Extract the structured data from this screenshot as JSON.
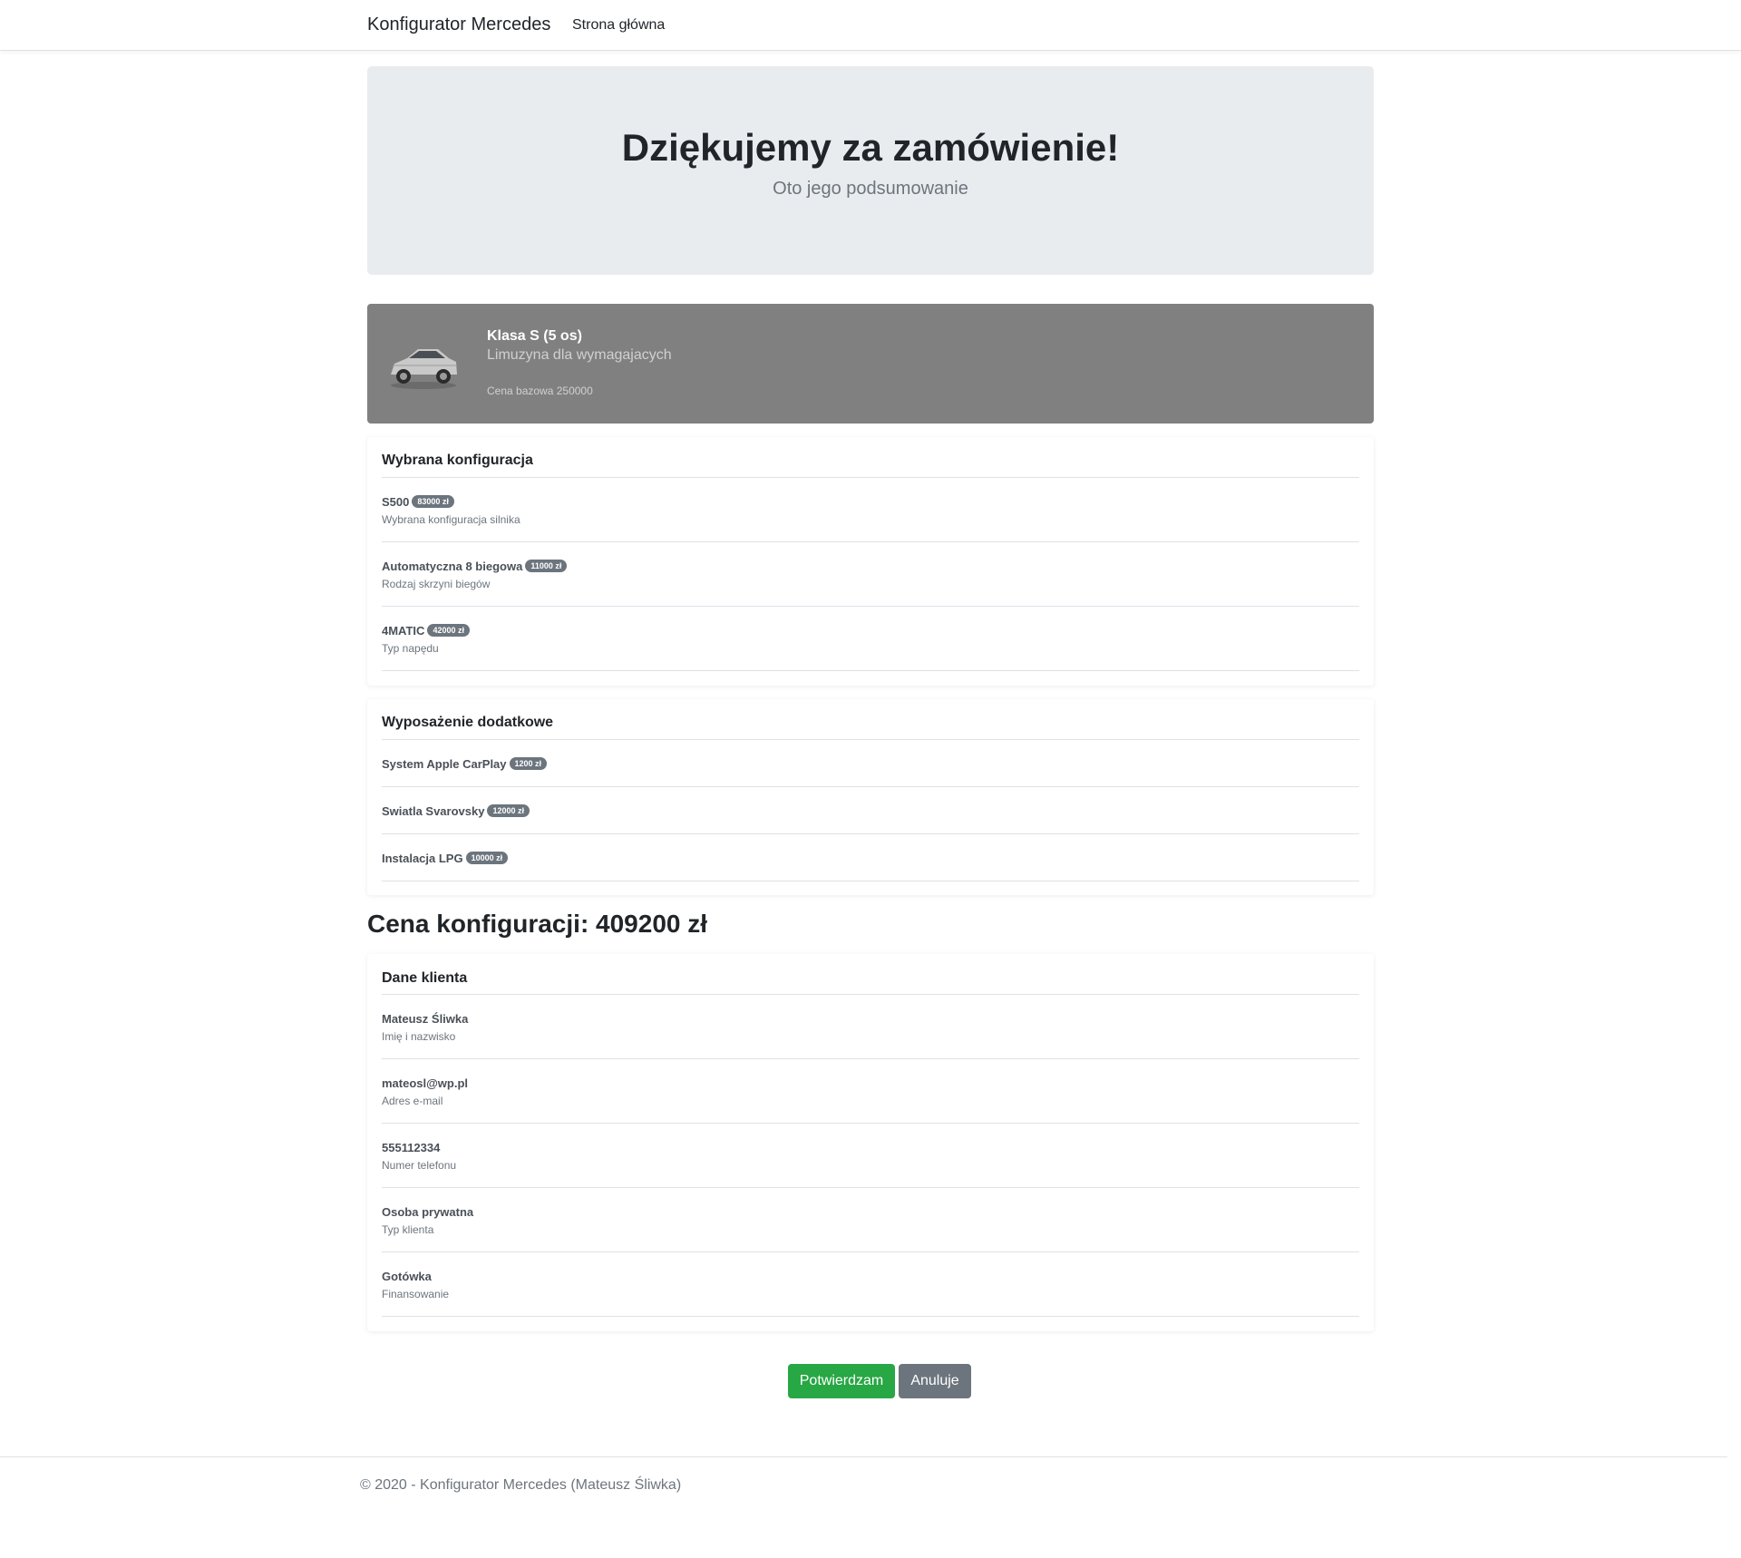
{
  "navbar": {
    "brand": "Konfigurator Mercedes",
    "home_link": "Strona główna"
  },
  "jumbotron": {
    "title": "Dziękujemy za zamówienie!",
    "lead": "Oto jego podsumowanie"
  },
  "model": {
    "title": "Klasa S (5 os)",
    "subtitle": "Limuzyna dla wymagajacych",
    "base_price": "Cena bazowa 250000"
  },
  "config": {
    "title": "Wybrana konfiguracja",
    "items": [
      {
        "name": "S500",
        "price": "83000 zł",
        "desc": "Wybrana konfiguracja silnika"
      },
      {
        "name": "Automatyczna 8 biegowa",
        "price": "11000 zł",
        "desc": "Rodzaj skrzyni biegów"
      },
      {
        "name": "4MATIC",
        "price": "42000 zł",
        "desc": "Typ napędu"
      }
    ]
  },
  "extras": {
    "title": "Wyposażenie dodatkowe",
    "items": [
      {
        "name": "System Apple CarPlay",
        "price": "1200 zł"
      },
      {
        "name": "Swiatla Svarovsky",
        "price": "12000 zł"
      },
      {
        "name": "Instalacja LPG",
        "price": "10000 zł"
      }
    ]
  },
  "total": {
    "label": "Cena konfiguracji: 409200 zł"
  },
  "client": {
    "title": "Dane klienta",
    "items": [
      {
        "value": "Mateusz Śliwka",
        "label": "Imię i nazwisko"
      },
      {
        "value": "mateosl@wp.pl",
        "label": "Adres e-mail"
      },
      {
        "value": "555112334",
        "label": "Numer telefonu"
      },
      {
        "value": "Osoba prywatna",
        "label": "Typ klienta"
      },
      {
        "value": "Gotówka",
        "label": "Finansowanie"
      }
    ]
  },
  "actions": {
    "confirm": "Potwierdzam",
    "cancel": "Anuluje"
  },
  "footer": {
    "text": "© 2020 - Konfigurator Mercedes (Mateusz Śliwka)"
  },
  "colors": {
    "success": "#28a745",
    "secondary": "#6c757d",
    "jumbotron_bg": "#e9ecef",
    "model_card_bg": "#808080"
  }
}
